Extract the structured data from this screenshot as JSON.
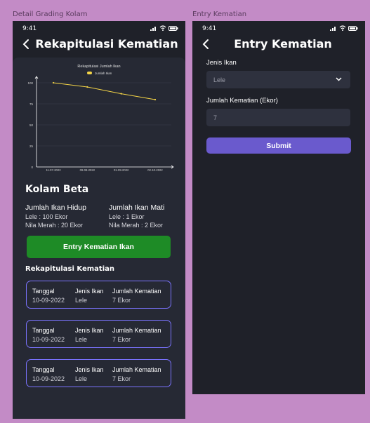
{
  "frames": {
    "left_label": "Detail Grading Kolam",
    "right_label": "Entry Kematian"
  },
  "left_screen": {
    "status_time": "9:41",
    "title": "Rekapitulasi Kematian",
    "pond_name": "Kolam Beta",
    "alive": {
      "heading": "Jumlah Ikan Hidup",
      "line1": "Lele : 100 Ekor",
      "line2": "Nila Merah : 20 Ekor"
    },
    "dead": {
      "heading": "Jumlah Ikan Mati",
      "line1": "Lele : 1 Ekor",
      "line2": "Nila Merah : 2 Ekor"
    },
    "entry_button": "Entry Kematian Ikan",
    "recap_heading": "Rekapitulasi Kematian",
    "records": [
      {
        "date_label": "Tanggal",
        "date": "10-09-2022",
        "type_label": "Jenis Ikan",
        "type": "Lele",
        "count_label": "Jumlah Kematian",
        "count": "7 Ekor"
      },
      {
        "date_label": "Tanggal",
        "date": "10-09-2022",
        "type_label": "Jenis Ikan",
        "type": "Lele",
        "count_label": "Jumlah Kematian",
        "count": "7 Ekor"
      },
      {
        "date_label": "Tanggal",
        "date": "10-09-2022",
        "type_label": "Jenis Ikan",
        "type": "Lele",
        "count_label": "Jumlah Kematian",
        "count": "7 Ekor"
      }
    ]
  },
  "chart_data": {
    "type": "line",
    "title": "Rekapitulasi Jumlah Ikan",
    "legend_position": "top",
    "categories": [
      "11-07-2022",
      "09-08-2022",
      "01-09-2022",
      "02-10-2022"
    ],
    "series": [
      {
        "name": "Jumlah Ikan",
        "values": [
          100,
          95,
          87,
          80
        ],
        "color": "#f5d547"
      }
    ],
    "yticks": [
      "0",
      "25",
      "50",
      "75",
      "100"
    ],
    "ylim": [
      0,
      100
    ],
    "grid": true
  },
  "right_screen": {
    "status_time": "9:41",
    "title": "Entry Kematian",
    "fish_type_label": "Jenis Ikan",
    "fish_type_value": "Lele",
    "count_label": "Jumlah Kematian (Ekor)",
    "count_placeholder": "7",
    "submit_label": "Submit"
  },
  "colors": {
    "background": "#c38bc6",
    "phone": "#1f2129",
    "green": "#1e8b26",
    "purple_button": "#6a5acd",
    "card_border": "#7b73ff"
  }
}
